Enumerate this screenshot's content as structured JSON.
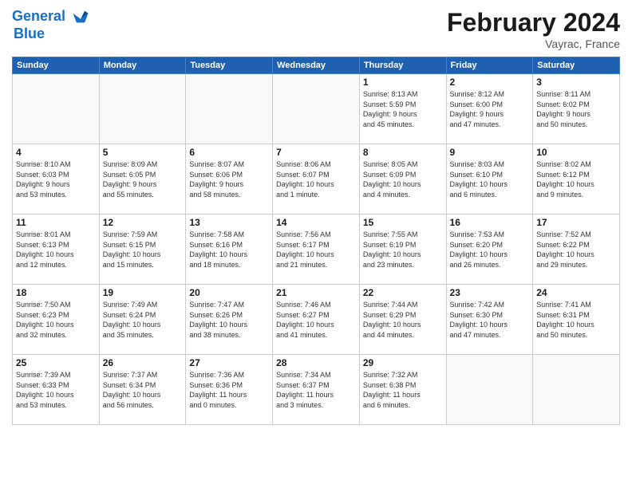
{
  "header": {
    "logo_line1": "General",
    "logo_line2": "Blue",
    "month": "February 2024",
    "location": "Vayrac, France"
  },
  "weekdays": [
    "Sunday",
    "Monday",
    "Tuesday",
    "Wednesday",
    "Thursday",
    "Friday",
    "Saturday"
  ],
  "weeks": [
    [
      {
        "day": "",
        "info": ""
      },
      {
        "day": "",
        "info": ""
      },
      {
        "day": "",
        "info": ""
      },
      {
        "day": "",
        "info": ""
      },
      {
        "day": "1",
        "info": "Sunrise: 8:13 AM\nSunset: 5:59 PM\nDaylight: 9 hours\nand 45 minutes."
      },
      {
        "day": "2",
        "info": "Sunrise: 8:12 AM\nSunset: 6:00 PM\nDaylight: 9 hours\nand 47 minutes."
      },
      {
        "day": "3",
        "info": "Sunrise: 8:11 AM\nSunset: 6:02 PM\nDaylight: 9 hours\nand 50 minutes."
      }
    ],
    [
      {
        "day": "4",
        "info": "Sunrise: 8:10 AM\nSunset: 6:03 PM\nDaylight: 9 hours\nand 53 minutes."
      },
      {
        "day": "5",
        "info": "Sunrise: 8:09 AM\nSunset: 6:05 PM\nDaylight: 9 hours\nand 55 minutes."
      },
      {
        "day": "6",
        "info": "Sunrise: 8:07 AM\nSunset: 6:06 PM\nDaylight: 9 hours\nand 58 minutes."
      },
      {
        "day": "7",
        "info": "Sunrise: 8:06 AM\nSunset: 6:07 PM\nDaylight: 10 hours\nand 1 minute."
      },
      {
        "day": "8",
        "info": "Sunrise: 8:05 AM\nSunset: 6:09 PM\nDaylight: 10 hours\nand 4 minutes."
      },
      {
        "day": "9",
        "info": "Sunrise: 8:03 AM\nSunset: 6:10 PM\nDaylight: 10 hours\nand 6 minutes."
      },
      {
        "day": "10",
        "info": "Sunrise: 8:02 AM\nSunset: 6:12 PM\nDaylight: 10 hours\nand 9 minutes."
      }
    ],
    [
      {
        "day": "11",
        "info": "Sunrise: 8:01 AM\nSunset: 6:13 PM\nDaylight: 10 hours\nand 12 minutes."
      },
      {
        "day": "12",
        "info": "Sunrise: 7:59 AM\nSunset: 6:15 PM\nDaylight: 10 hours\nand 15 minutes."
      },
      {
        "day": "13",
        "info": "Sunrise: 7:58 AM\nSunset: 6:16 PM\nDaylight: 10 hours\nand 18 minutes."
      },
      {
        "day": "14",
        "info": "Sunrise: 7:56 AM\nSunset: 6:17 PM\nDaylight: 10 hours\nand 21 minutes."
      },
      {
        "day": "15",
        "info": "Sunrise: 7:55 AM\nSunset: 6:19 PM\nDaylight: 10 hours\nand 23 minutes."
      },
      {
        "day": "16",
        "info": "Sunrise: 7:53 AM\nSunset: 6:20 PM\nDaylight: 10 hours\nand 26 minutes."
      },
      {
        "day": "17",
        "info": "Sunrise: 7:52 AM\nSunset: 6:22 PM\nDaylight: 10 hours\nand 29 minutes."
      }
    ],
    [
      {
        "day": "18",
        "info": "Sunrise: 7:50 AM\nSunset: 6:23 PM\nDaylight: 10 hours\nand 32 minutes."
      },
      {
        "day": "19",
        "info": "Sunrise: 7:49 AM\nSunset: 6:24 PM\nDaylight: 10 hours\nand 35 minutes."
      },
      {
        "day": "20",
        "info": "Sunrise: 7:47 AM\nSunset: 6:26 PM\nDaylight: 10 hours\nand 38 minutes."
      },
      {
        "day": "21",
        "info": "Sunrise: 7:46 AM\nSunset: 6:27 PM\nDaylight: 10 hours\nand 41 minutes."
      },
      {
        "day": "22",
        "info": "Sunrise: 7:44 AM\nSunset: 6:29 PM\nDaylight: 10 hours\nand 44 minutes."
      },
      {
        "day": "23",
        "info": "Sunrise: 7:42 AM\nSunset: 6:30 PM\nDaylight: 10 hours\nand 47 minutes."
      },
      {
        "day": "24",
        "info": "Sunrise: 7:41 AM\nSunset: 6:31 PM\nDaylight: 10 hours\nand 50 minutes."
      }
    ],
    [
      {
        "day": "25",
        "info": "Sunrise: 7:39 AM\nSunset: 6:33 PM\nDaylight: 10 hours\nand 53 minutes."
      },
      {
        "day": "26",
        "info": "Sunrise: 7:37 AM\nSunset: 6:34 PM\nDaylight: 10 hours\nand 56 minutes."
      },
      {
        "day": "27",
        "info": "Sunrise: 7:36 AM\nSunset: 6:36 PM\nDaylight: 11 hours\nand 0 minutes."
      },
      {
        "day": "28",
        "info": "Sunrise: 7:34 AM\nSunset: 6:37 PM\nDaylight: 11 hours\nand 3 minutes."
      },
      {
        "day": "29",
        "info": "Sunrise: 7:32 AM\nSunset: 6:38 PM\nDaylight: 11 hours\nand 6 minutes."
      },
      {
        "day": "",
        "info": ""
      },
      {
        "day": "",
        "info": ""
      }
    ]
  ]
}
